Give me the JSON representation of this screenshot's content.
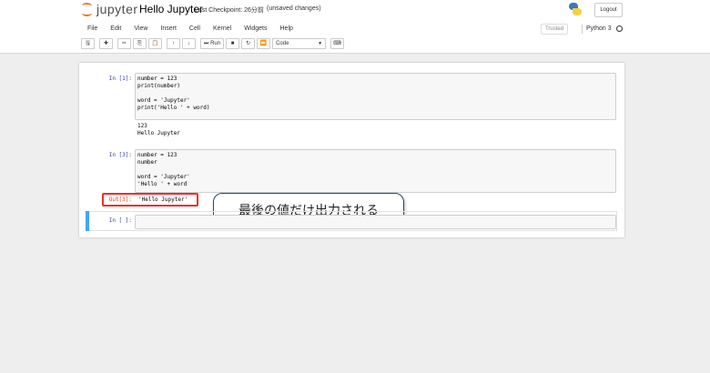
{
  "header": {
    "logo_text": "jupyter",
    "notebook_title": "Hello Jupyter",
    "checkpoint": "Last Checkpoint: 26分前",
    "unsaved": "(unsaved changes)",
    "logout_label": "Logout"
  },
  "menu": {
    "items": [
      "File",
      "Edit",
      "View",
      "Insert",
      "Cell",
      "Kernel",
      "Widgets",
      "Help"
    ],
    "trusted": "Trusted",
    "kernel": "Python 3"
  },
  "toolbar": {
    "run_label": "Run",
    "cell_type": "Code"
  },
  "cells": [
    {
      "prompt": "In [1]:",
      "code": [
        "number = 123",
        "print(number)",
        "",
        "word = 'Jupyter'",
        "print('Hello ' + word)"
      ],
      "stdout": [
        "123",
        "Hello Jupyter"
      ]
    },
    {
      "prompt": "In [3]:",
      "code": [
        "number = 123",
        "number",
        "",
        "word = 'Jupyter'",
        "'Hello ' + word"
      ],
      "out_prompt": "Out[3]:",
      "out_value": "'Hello Jupyter'"
    },
    {
      "prompt": "In [ ]:",
      "code": []
    }
  ],
  "annotation": {
    "text": "最後の値だけ出力される",
    "highlight_color": "#e5322d"
  },
  "colors": {
    "accent_orange": "#f37626",
    "selected_cell_bar": "#42a5f5",
    "in_prompt": "#303f9f",
    "out_prompt": "#d84315"
  }
}
